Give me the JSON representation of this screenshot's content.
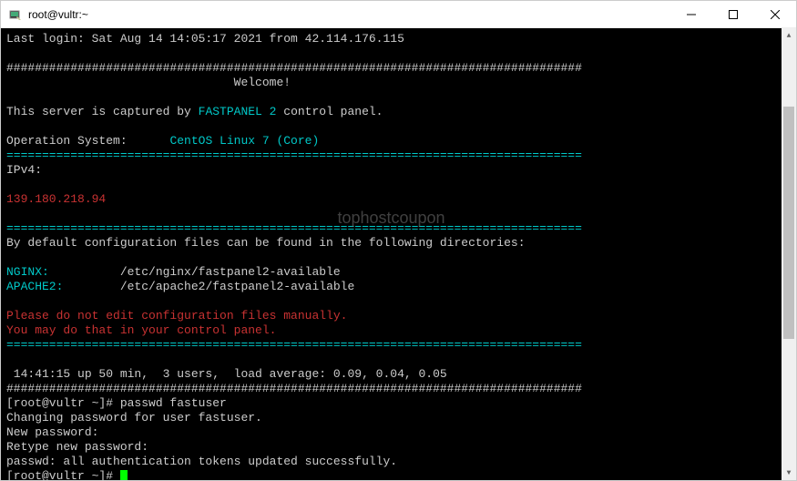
{
  "window": {
    "title": "root@vultr:~"
  },
  "terminal": {
    "last_login": "Last login: Sat Aug 14 14:05:17 2021 from 42.114.176.115",
    "hash_line": "#################################################################################",
    "welcome": "                                Welcome!",
    "captured_pre": "This server is captured by ",
    "captured_link": "FASTPANEL 2",
    "captured_post": " control panel.",
    "os_label": "Operation System:      ",
    "os_value": "CentOS Linux 7 (Core)",
    "eq_line": "=================================================================================",
    "ipv4_label": "IPv4:",
    "ipv4_value": "139.180.218.94",
    "config_text": "By default configuration files can be found in the following directories:",
    "nginx_label": "NGINX:",
    "nginx_path": "          /etc/nginx/fastpanel2-available",
    "apache_label": "APACHE2:",
    "apache_path": "        /etc/apache2/fastpanel2-available",
    "warn1": "Please do not edit configuration files manually.",
    "warn2": "You may do that in your control panel.",
    "uptime": " 14:41:15 up 50 min,  3 users,  load average: 0.09, 0.04, 0.05",
    "prompt1": "[root@vultr ~]# ",
    "cmd1": "passwd fastuser",
    "pwd1": "Changing password for user fastuser.",
    "pwd2": "New password:",
    "pwd3": "Retype new password:",
    "pwd4": "passwd: all authentication tokens updated successfully.",
    "prompt2": "[root@vultr ~]# "
  },
  "watermark": "tophostcoupon"
}
